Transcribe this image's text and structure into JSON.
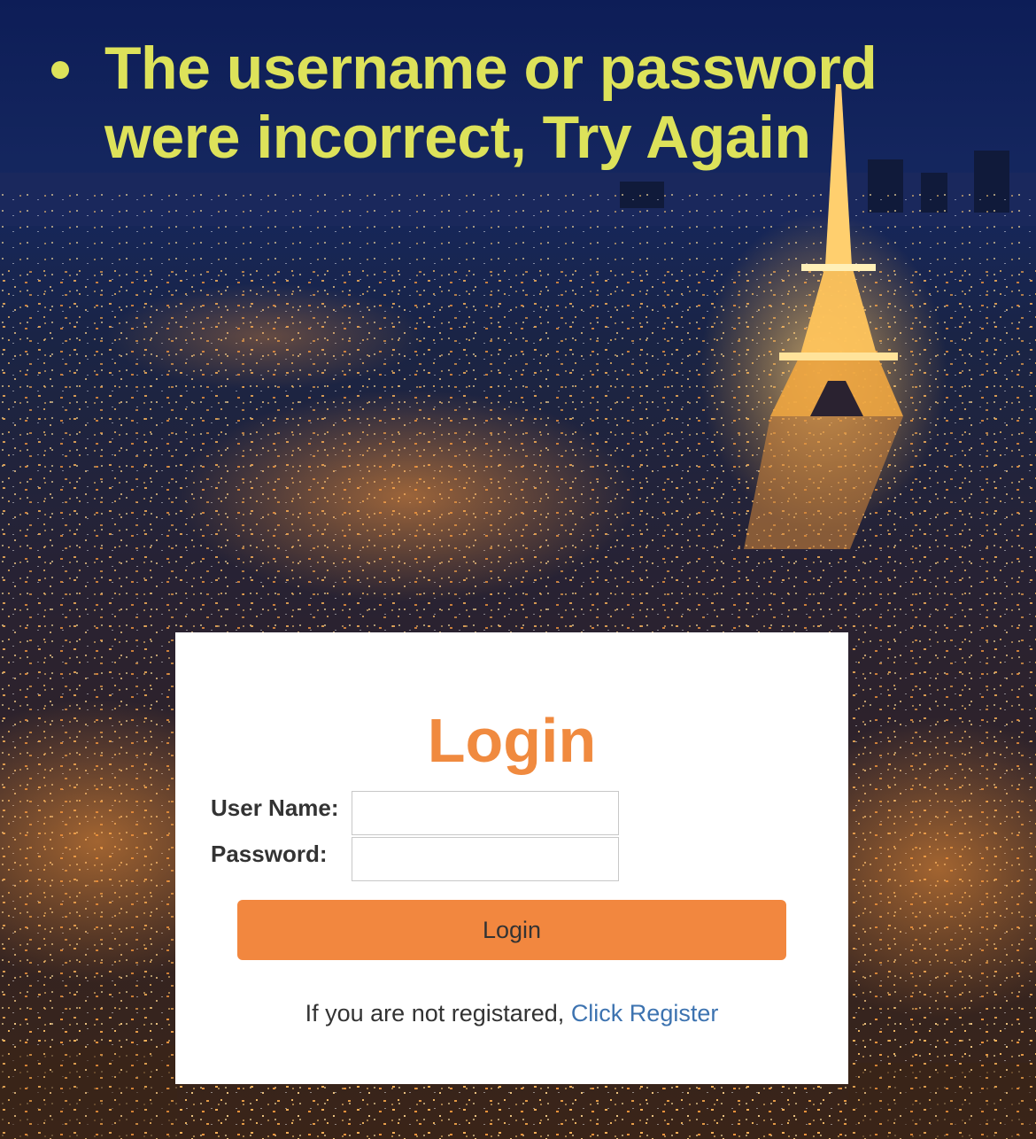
{
  "error": {
    "message": "The username or password were incorrect, Try Again",
    "color": "#dde25a"
  },
  "login_form": {
    "title": "Login",
    "username_label": "User Name:",
    "username_value": "",
    "password_label": "Password:",
    "password_value": "",
    "submit_label": "Login",
    "register_prompt": "If you are not registared,",
    "register_link": "Click Register"
  },
  "colors": {
    "accent": "#f2873f",
    "title": "#f08a3f",
    "link": "#3d73b0",
    "card": "#ffffff"
  },
  "background": {
    "description_icon": "night-city-background"
  }
}
